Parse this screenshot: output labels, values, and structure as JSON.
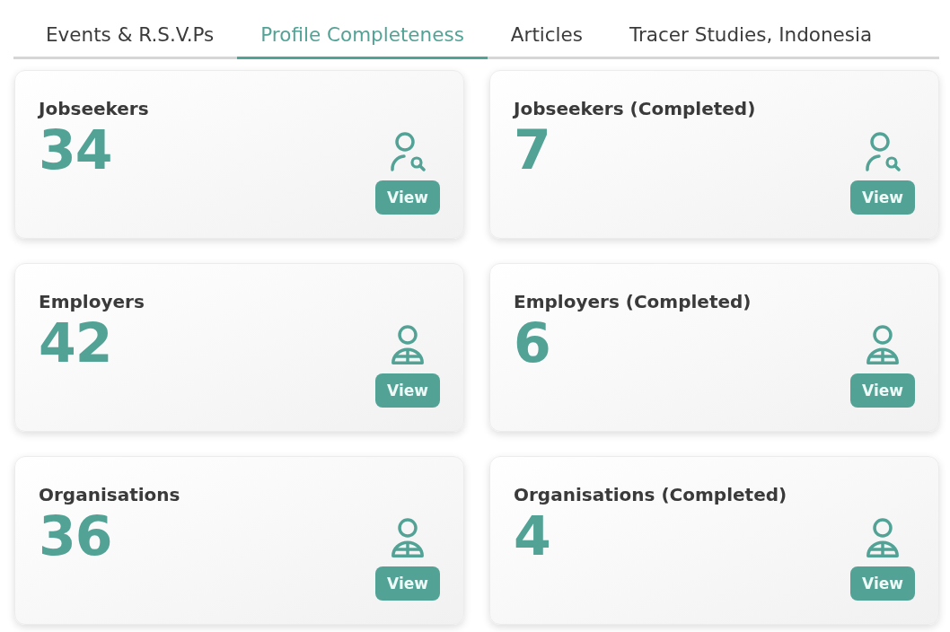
{
  "tabs": [
    {
      "label": "Events & R.S.V.Ps",
      "selected": false
    },
    {
      "label": "Profile Completeness",
      "selected": true
    },
    {
      "label": "Articles",
      "selected": false
    },
    {
      "label": "Tracer Studies, Indonesia",
      "selected": false
    }
  ],
  "cards": [
    {
      "title": "Jobseekers",
      "count": "34",
      "kind": "seeker",
      "button": "View"
    },
    {
      "title": "Jobseekers (Completed)",
      "count": "7",
      "kind": "seeker",
      "button": "View"
    },
    {
      "title": "Employers",
      "count": "42",
      "kind": "member",
      "button": "View"
    },
    {
      "title": "Employers (Completed)",
      "count": "6",
      "kind": "member",
      "button": "View"
    },
    {
      "title": "Organisations",
      "count": "36",
      "kind": "member",
      "button": "View"
    },
    {
      "title": "Organisations (Completed)",
      "count": "4",
      "kind": "member",
      "button": "View"
    }
  ]
}
